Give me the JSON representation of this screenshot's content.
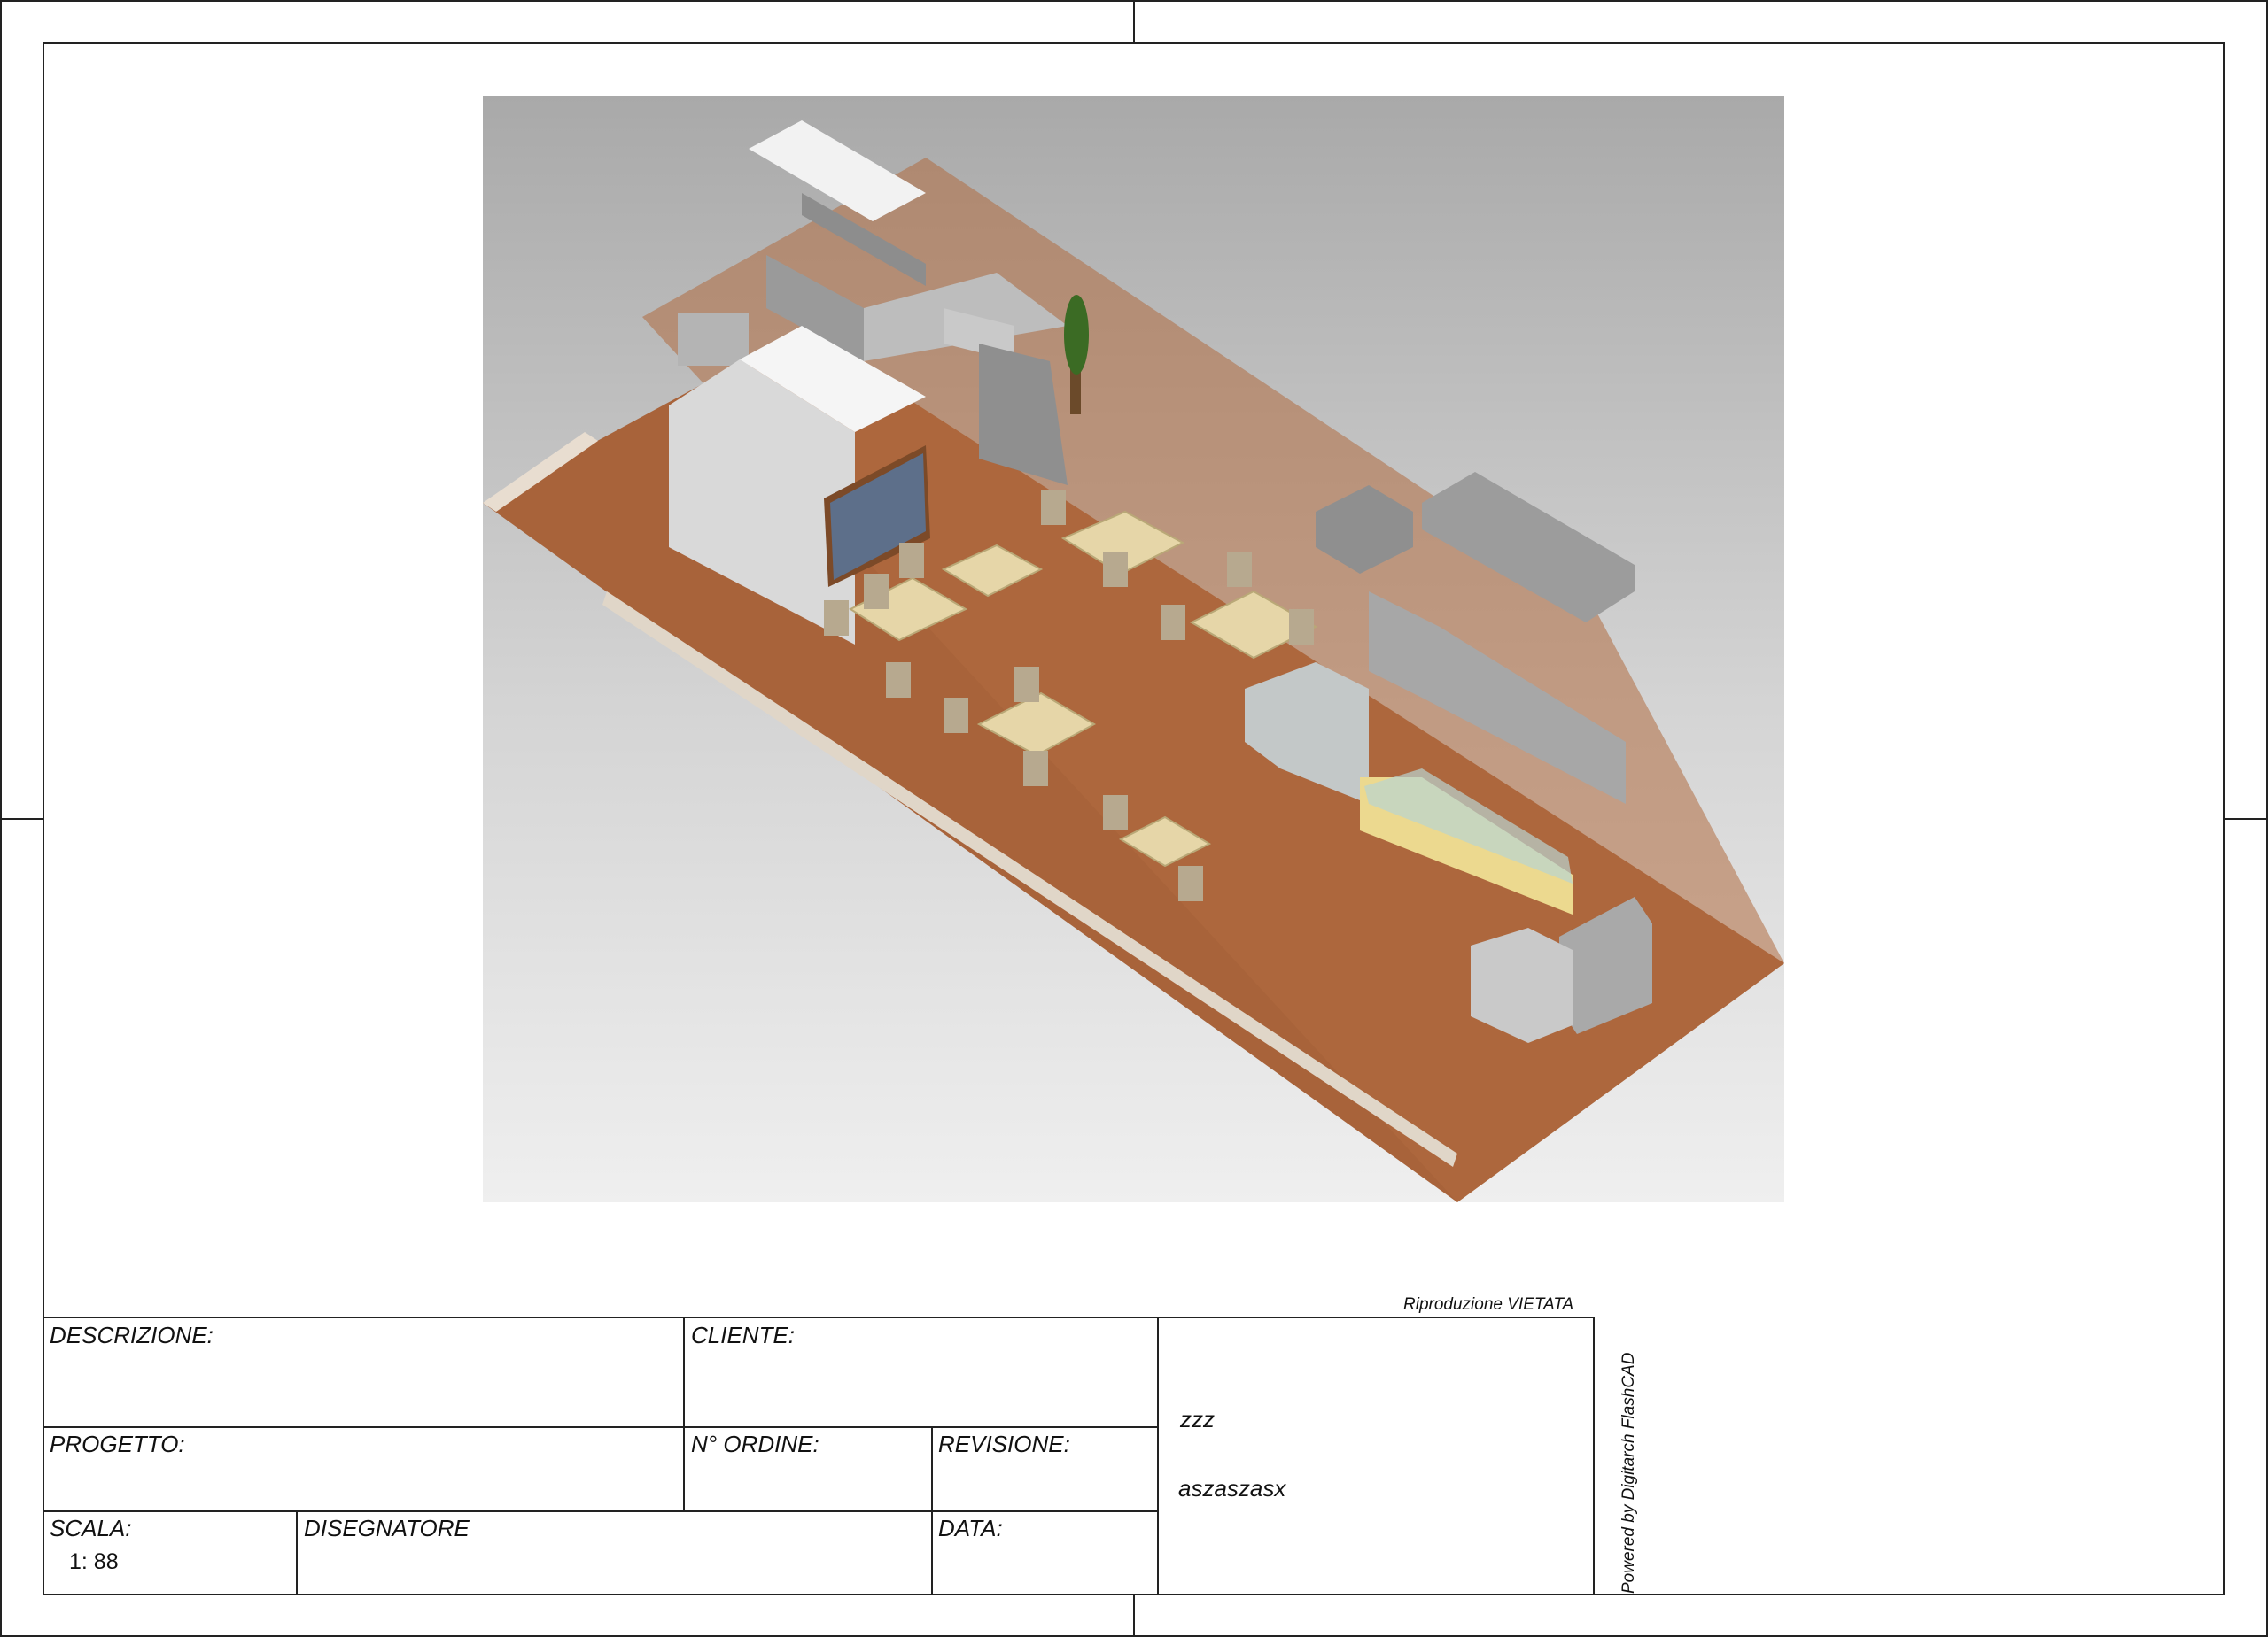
{
  "notice": "Riproduzione VIETATA",
  "powered_by": "Powered by Digitarch FlashCAD",
  "title_block": {
    "descrizione_label": "DESCRIZIONE:",
    "cliente_label": "CLIENTE:",
    "progetto_label": "PROGETTO:",
    "ordine_label": "N° ORDINE:",
    "revisione_label": "REVISIONE:",
    "scala_label": "SCALA:",
    "scala_value": "1: 88",
    "disegnatore_label": "DISEGNATORE",
    "data_label": "DATA:",
    "info_line1": "zzz",
    "info_line2": "aszaszasx"
  },
  "colors": {
    "floor": "#a8633a",
    "steel": "#a7a7a7",
    "table": "#e6d6a8"
  }
}
